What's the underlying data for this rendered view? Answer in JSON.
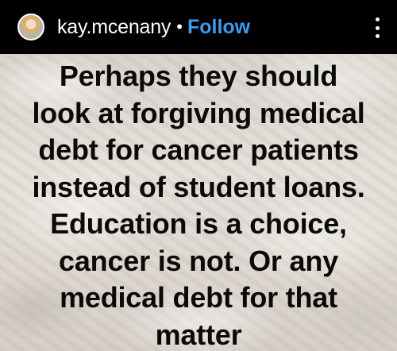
{
  "header": {
    "username": "kay.mcenany",
    "separator": "•",
    "follow_label": "Follow"
  },
  "post": {
    "lines": [
      "Perhaps they should",
      "look at forgiving medical",
      "debt for cancer patients",
      "instead of student loans.",
      "Education is a choice,",
      "cancer is not. Or any",
      "medical debt for that",
      "matter"
    ]
  },
  "icons": {
    "avatar": "profile-photo",
    "more": "more-vertical-icon"
  }
}
